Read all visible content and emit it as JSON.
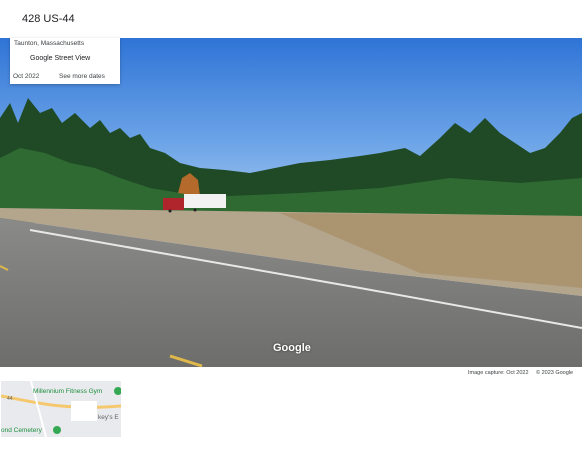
{
  "header": {
    "title": "428 US-44"
  },
  "info_card": {
    "location": "Taunton, Massachusetts",
    "service": "Google Street View",
    "date": "Oct 2022",
    "more_dates": "See more dates"
  },
  "panorama": {
    "watermark": "Google"
  },
  "footer": {
    "image_capture": "Image capture: Oct 2022",
    "copyright": "© 2023 Google"
  },
  "minimap": {
    "poi_gym": "Millennium Fitness Gym",
    "route_shield": "44",
    "poi_partial": "key's E",
    "poi_cemetery": "ond Cemetery"
  },
  "colors": {
    "sky": "#4d8fe0",
    "map_bg": "#e8eaed",
    "poi_green": "#1e8e3e"
  }
}
